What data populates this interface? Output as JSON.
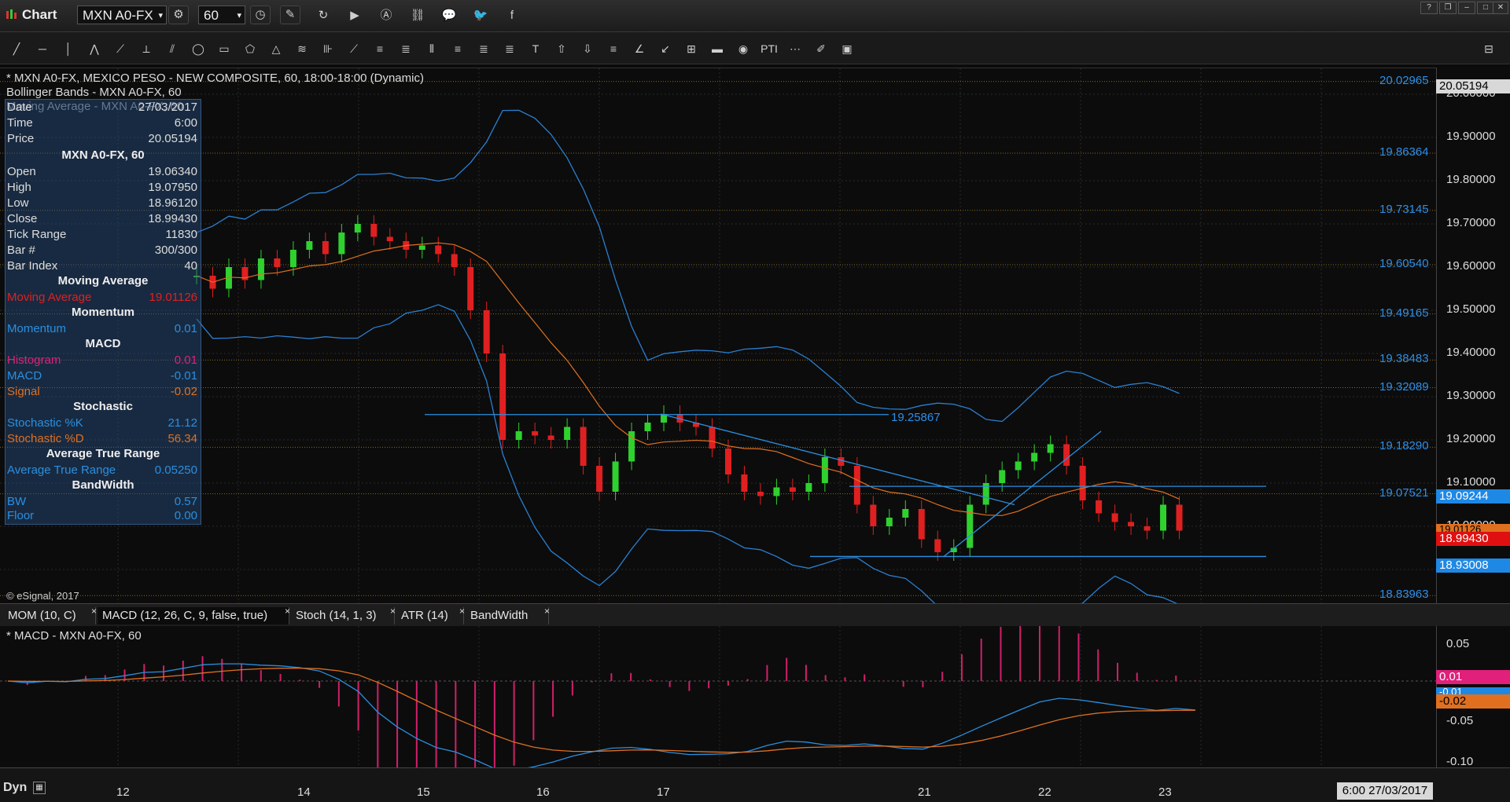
{
  "app": {
    "title": "Chart",
    "symbol": "MXN A0-FX",
    "interval": "60",
    "dyn": "Dyn"
  },
  "colors": {
    "bg": "#0c0c0c",
    "up": "#2fd12f",
    "down": "#e02020",
    "band": "#2a7fd0",
    "ma": "#e07020",
    "ma2": "#d02020",
    "macd": "#2a8fe0",
    "signal": "#e07020",
    "hist": "#d0206a"
  },
  "toolbar_icons": [
    "line-tool-icon",
    "horizontal-line-icon",
    "vertical-line-icon",
    "polyline-icon",
    "trend-line-icon",
    "gann-icon",
    "pitchfork-icon",
    "ellipse-icon",
    "rectangle-icon",
    "triangle-icon",
    "channel-icon",
    "fib-fan-icon",
    "fib-icon",
    "regression-icon",
    "fib-retracement-icon",
    "fib-extension-icon",
    "cycle-lines-icon",
    "arc-icon",
    "speed-lines-icon",
    "text-icon",
    "arrow-up-icon",
    "arrow-down-icon",
    "pointer-icon",
    "measure-icon",
    "ruler-icon",
    "grid-icon",
    "mob-icon",
    "eye-icon",
    "pti-icon",
    "delete-icon",
    "eraser-icon",
    "object-list-icon",
    "magnet-icon"
  ],
  "chart": {
    "header": "* MXN A0-FX, MEXICO PESO - NEW COMPOSITE, 60, 18:00-18:00 (Dynamic)",
    "studies": [
      "Bollinger Bands - MXN A0-FX, 60",
      "Moving Average - MXN A0-FX, 60"
    ],
    "copyright": "© eSignal, 2017",
    "level_label": "19.25867"
  },
  "datawindow": {
    "date_label": "Date",
    "date": "27/03/2017",
    "time_label": "Time",
    "time": "6:00",
    "price_label": "Price",
    "price": "20.05194",
    "symbol_head": "MXN A0-FX, 60",
    "rows": [
      {
        "k": "Open",
        "v": "19.06340"
      },
      {
        "k": "High",
        "v": "19.07950"
      },
      {
        "k": "Low",
        "v": "18.96120"
      },
      {
        "k": "Close",
        "v": "18.99430"
      },
      {
        "k": "Tick Range",
        "v": "11830"
      },
      {
        "k": "Bar #",
        "v": "300/300"
      },
      {
        "k": "Bar Index",
        "v": "40"
      }
    ],
    "ma_head": "Moving Average",
    "ma_k": "Moving Average",
    "ma_v": "19.01126",
    "mom_head": "Momentum",
    "mom_k": "Momentum",
    "mom_v": "0.01",
    "macd_head": "MACD",
    "hist_k": "Histogram",
    "hist_v": "0.01",
    "macd_k": "MACD",
    "macd_v": "-0.01",
    "signal_k": "Signal",
    "signal_v": "-0.02",
    "stoch_head": "Stochastic",
    "k_k": "Stochastic %K",
    "k_v": "21.12",
    "d_k": "Stochastic %D",
    "d_v": "56.34",
    "atr_head": "Average True Range",
    "atr_k": "Average True Range",
    "atr_v": "0.05250",
    "bw_head": "BandWidth",
    "bw_k": "BW",
    "bw_v": "0.57",
    "floor_k": "Floor",
    "floor_v": "0.00"
  },
  "price_scale": [
    "20.00000",
    "19.90000",
    "19.80000",
    "19.70000",
    "19.60000",
    "19.50000",
    "19.40000",
    "19.30000",
    "19.20000",
    "19.10000",
    "19.00000",
    "18.90000"
  ],
  "fib_levels": [
    "20.02965",
    "19.86364",
    "19.73145",
    "19.60540",
    "19.49165",
    "19.38483",
    "19.32089",
    "19.18290",
    "19.07521",
    "18.83963"
  ],
  "price_boxes": {
    "top": "20.05194",
    "upper": "19.09244",
    "ma": "19.01126",
    "close": "18.99430",
    "lower": "18.93008"
  },
  "tabs": [
    {
      "label": "MOM (10, C)"
    },
    {
      "label": "MACD (12, 26, C, 9, false, true)"
    },
    {
      "label": "Stoch (14, 1, 3)"
    },
    {
      "label": "ATR (14)"
    },
    {
      "label": "BandWidth"
    }
  ],
  "macd_panel": {
    "header": "* MACD - MXN A0-FX, 60",
    "scale": [
      "0.05",
      "-0.05",
      "-0.10"
    ],
    "boxes": {
      "hist": "0.01",
      "macd": "-0.01",
      "signal": "-0.02"
    }
  },
  "x_axis": [
    "12",
    "14",
    "15",
    "16",
    "17",
    "21",
    "22",
    "23"
  ],
  "cursor_time": "6:00 27/03/2017",
  "chart_data": {
    "type": "candlestick",
    "ylim": [
      18.82,
      20.06
    ],
    "closes": [
      19.58,
      19.55,
      19.6,
      19.57,
      19.62,
      19.6,
      19.64,
      19.66,
      19.63,
      19.68,
      19.7,
      19.67,
      19.66,
      19.64,
      19.65,
      19.63,
      19.6,
      19.5,
      19.4,
      19.2,
      19.22,
      19.21,
      19.2,
      19.23,
      19.14,
      19.08,
      19.15,
      19.22,
      19.24,
      19.26,
      19.24,
      19.23,
      19.18,
      19.12,
      19.08,
      19.07,
      19.09,
      19.08,
      19.1,
      19.16,
      19.14,
      19.05,
      19.0,
      19.02,
      19.04,
      18.97,
      18.94,
      18.95,
      19.05,
      19.1,
      19.13,
      19.15,
      19.17,
      19.19,
      19.14,
      19.06,
      19.03,
      19.01,
      19.0,
      18.99,
      19.05,
      18.99
    ]
  }
}
